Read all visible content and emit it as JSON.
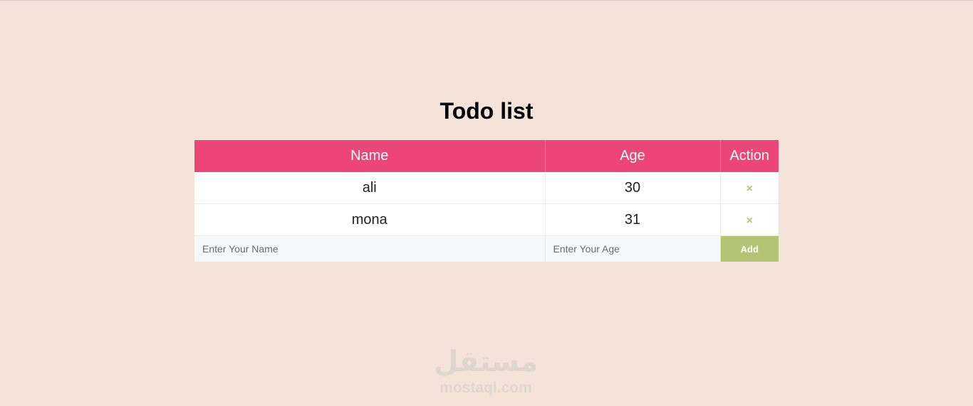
{
  "title": "Todo list",
  "table": {
    "headers": [
      "Name",
      "Age",
      "Action"
    ],
    "rows": [
      {
        "name": "ali",
        "age": "30",
        "action": "×"
      },
      {
        "name": "mona",
        "age": "31",
        "action": "×"
      }
    ]
  },
  "form": {
    "name_placeholder": "Enter Your Name",
    "age_placeholder": "Enter Your Age",
    "add_label": "Add"
  },
  "watermark": {
    "arabic": "مستقل",
    "latin": "mostaql.com"
  },
  "colors": {
    "background": "#f4e3d9",
    "header": "#ec4577",
    "accent": "#b5c474"
  },
  "icons": {
    "delete": "close-icon"
  }
}
